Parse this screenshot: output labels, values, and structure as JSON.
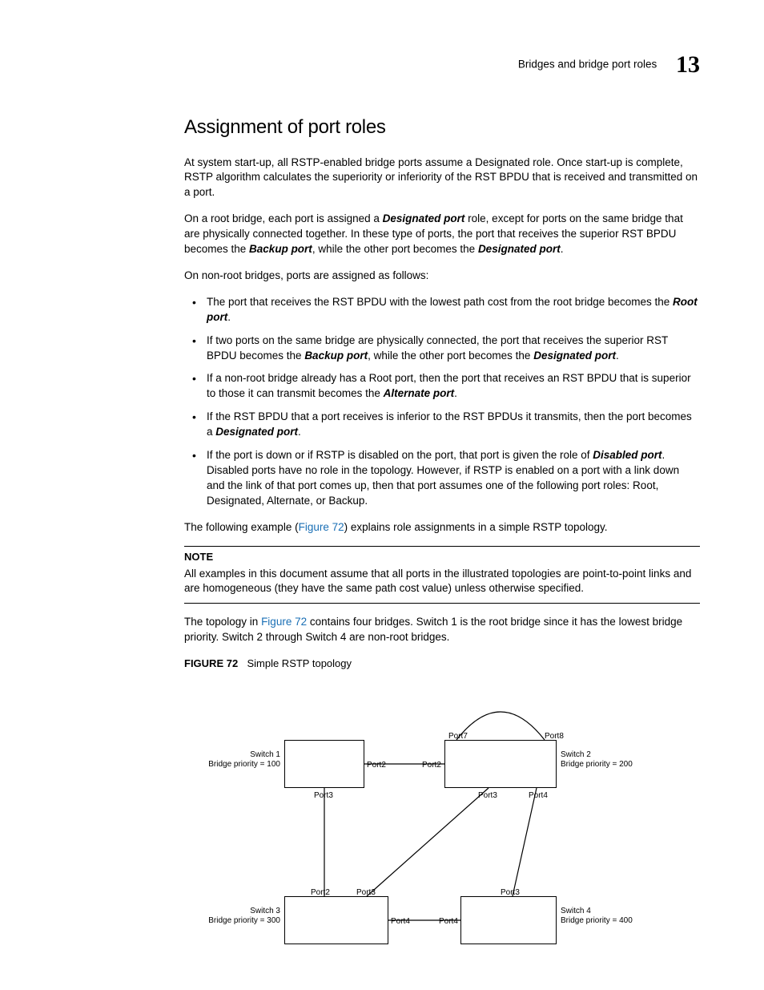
{
  "header": {
    "section": "Bridges and bridge port roles",
    "chapter_number": "13"
  },
  "title": "Assignment of port roles",
  "p1": "At system start-up, all RSTP-enabled bridge ports assume a Designated role. Once start-up is complete, RSTP algorithm calculates the superiority or inferiority of the RST BPDU that is received and transmitted on a port.",
  "p2a": "On a root bridge, each port is assigned a ",
  "p2_role1": "Designated port",
  "p2b": " role, except for ports on the same bridge that are physically connected together. In these type of ports, the port that receives the superior RST BPDU becomes the ",
  "p2_role2": "Backup port",
  "p2c": ", while the other port becomes the ",
  "p2_role3": "Designated port",
  "p2d": ".",
  "p3": "On non-root bridges, ports are assigned as follows:",
  "bullets": [
    {
      "a": "The port that receives the RST BPDU with the lowest path cost from the root bridge becomes the ",
      "r1": "Root port",
      "b": "."
    },
    {
      "a": "If two ports on the same bridge are physically connected, the port that receives the superior RST BPDU becomes the ",
      "r1": "Backup port",
      "b": ", while the other port becomes the ",
      "r2": "Designated port",
      "c": "."
    },
    {
      "a": "If a non-root bridge already has a Root port, then the port that receives an RST BPDU that is superior to those it can transmit becomes the ",
      "r1": "Alternate port",
      "b": "."
    },
    {
      "a": "If the RST BPDU that a port receives is inferior to the RST BPDUs it transmits, then the port becomes a ",
      "r1": "Designated port",
      "b": "."
    },
    {
      "a": "If the port is down or if RSTP is disabled on the port, that port is given the role of ",
      "r1": "Disabled port",
      "b": ". Disabled ports have no role in the topology. However, if RSTP is enabled on a port with a link down and the link of that port comes up, then that port assumes one of the following port roles: Root, Designated, Alternate, or Backup."
    }
  ],
  "p4a": "The following example (",
  "p4_link": "Figure 72",
  "p4b": ") explains role assignments in a simple RSTP topology.",
  "note_label": "NOTE",
  "note_text": "All examples in this document assume that all ports in the illustrated topologies are point-to-point links and are homogeneous (they have the same path cost value) unless otherwise specified.",
  "p5a": "The topology in ",
  "p5_link": "Figure 72",
  "p5b": " contains four bridges. Switch 1 is the root bridge since it has the lowest bridge priority. Switch 2 through Switch 4 are non-root bridges.",
  "figure_label": "FIGURE 72",
  "figure_caption": "Simple RSTP topology",
  "diagram": {
    "switches": [
      {
        "name": "Switch 1",
        "priority": "Bridge priority = 100"
      },
      {
        "name": "Switch 2",
        "priority": "Bridge priority = 200"
      },
      {
        "name": "Switch 3",
        "priority": "Bridge priority = 300"
      },
      {
        "name": "Switch 4",
        "priority": "Bridge priority = 400"
      }
    ],
    "ports": {
      "p7": "Port7",
      "p8": "Port8",
      "p2a": "Port2",
      "p2b": "Port2",
      "p3a": "Port3",
      "p3b": "Port3",
      "p4": "Port4",
      "p2c": "Port2",
      "p3c": "Port3",
      "p3d": "Port3",
      "p4b": "Port4",
      "p4c": "Port4"
    }
  }
}
